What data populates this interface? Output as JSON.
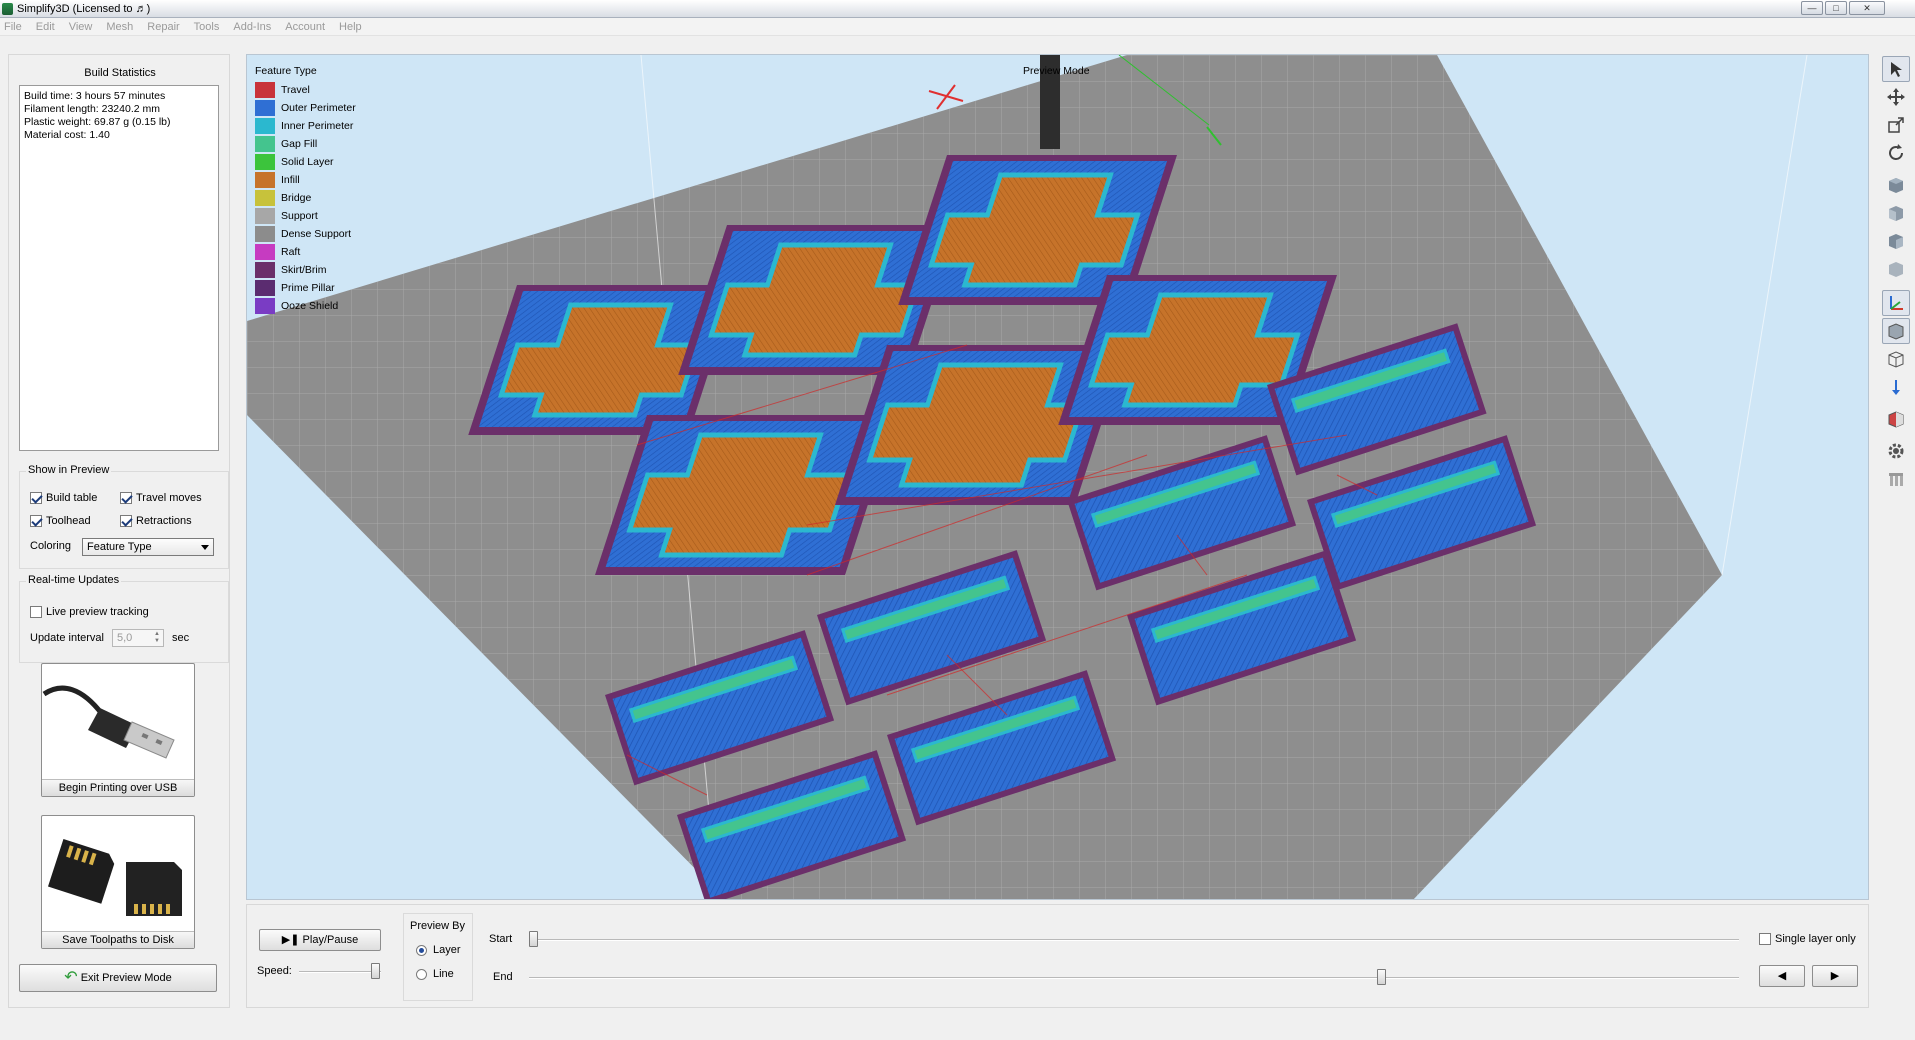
{
  "window": {
    "title": "Simplify3D (Licensed to ♬)",
    "controls": [
      "minimize-icon",
      "maximize-icon",
      "close-icon"
    ]
  },
  "menu": [
    "File",
    "Edit",
    "View",
    "Mesh",
    "Repair",
    "Tools",
    "Add-Ins",
    "Account",
    "Help"
  ],
  "build_stats": {
    "title": "Build Statistics",
    "lines": [
      "Build time: 3 hours 57 minutes",
      "Filament length: 23240.2 mm",
      "Plastic weight: 69.87 g (0.15 lb)",
      "Material cost: 1.40"
    ]
  },
  "show_in_preview": {
    "title": "Show in Preview",
    "build_table": {
      "label": "Build table",
      "checked": true
    },
    "travel_moves": {
      "label": "Travel moves",
      "checked": true
    },
    "toolhead": {
      "label": "Toolhead",
      "checked": true
    },
    "retractions": {
      "label": "Retractions",
      "checked": true
    },
    "coloring_label": "Coloring",
    "coloring_value": "Feature Type"
  },
  "realtime": {
    "title": "Real-time Updates",
    "live_tracking": {
      "label": "Live preview tracking",
      "checked": false
    },
    "interval_label": "Update interval",
    "interval_value": "5,0",
    "interval_unit": "sec"
  },
  "actions": {
    "usb": "Begin Printing over USB",
    "disk": "Save Toolpaths to Disk",
    "exit": "Exit Preview Mode"
  },
  "viewport": {
    "mode_label": "Preview Mode",
    "legend_title": "Feature Type",
    "legend": [
      {
        "label": "Travel",
        "color": "#c8323a"
      },
      {
        "label": "Outer Perimeter",
        "color": "#2f6fd4"
      },
      {
        "label": "Inner Perimeter",
        "color": "#2bb8cf"
      },
      {
        "label": "Gap Fill",
        "color": "#44c48e"
      },
      {
        "label": "Solid Layer",
        "color": "#3cc43c"
      },
      {
        "label": "Infill",
        "color": "#c6732a"
      },
      {
        "label": "Bridge",
        "color": "#c7c23b"
      },
      {
        "label": "Support",
        "color": "#a7a7a7"
      },
      {
        "label": "Dense Support",
        "color": "#8c8c8c"
      },
      {
        "label": "Raft",
        "color": "#c63bc1"
      },
      {
        "label": "Skirt/Brim",
        "color": "#6b2f6a"
      },
      {
        "label": "Prime Pillar",
        "color": "#5b2c70"
      },
      {
        "label": "Ooze Shield",
        "color": "#7a3cc4"
      }
    ]
  },
  "playback": {
    "play_pause": "Play/Pause",
    "speed_label": "Speed:",
    "preview_by_title": "Preview By",
    "mode_layer": "Layer",
    "mode_line": "Line",
    "selected_mode": "Layer",
    "start_label": "Start",
    "end_label": "End",
    "single_layer": {
      "label": "Single layer only",
      "checked": false
    }
  }
}
